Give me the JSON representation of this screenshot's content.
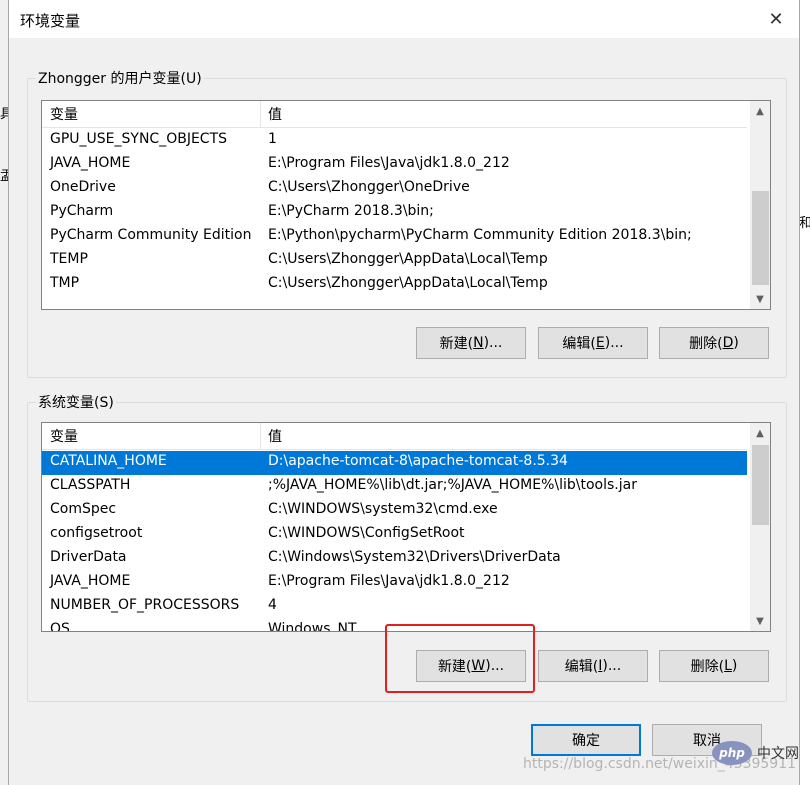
{
  "dialog": {
    "title": "环境变量"
  },
  "background_fragments": [
    "具。",
    "盂",
    "和"
  ],
  "user_vars": {
    "group_label": "Zhongger 的用户变量(U)",
    "headers": [
      "变量",
      "值"
    ],
    "rows": [
      {
        "name": "GPU_USE_SYNC_OBJECTS",
        "value": "1"
      },
      {
        "name": "JAVA_HOME",
        "value": "E:\\Program Files\\Java\\jdk1.8.0_212"
      },
      {
        "name": "OneDrive",
        "value": "C:\\Users\\Zhongger\\OneDrive"
      },
      {
        "name": "PyCharm",
        "value": "E:\\PyCharm 2018.3\\bin;"
      },
      {
        "name": "PyCharm Community Edition",
        "value": "E:\\Python\\pycharm\\PyCharm Community Edition 2018.3\\bin;"
      },
      {
        "name": "TEMP",
        "value": "C:\\Users\\Zhongger\\AppData\\Local\\Temp"
      },
      {
        "name": "TMP",
        "value": "C:\\Users\\Zhongger\\AppData\\Local\\Temp"
      }
    ],
    "buttons": {
      "new": {
        "prefix": "新建(",
        "key": "N",
        "suffix": ")..."
      },
      "edit": {
        "prefix": "编辑(",
        "key": "E",
        "suffix": ")..."
      },
      "delete": {
        "prefix": "删除(",
        "key": "D",
        "suffix": ")"
      }
    }
  },
  "system_vars": {
    "group_label": "系统变量(S)",
    "headers": [
      "变量",
      "值"
    ],
    "rows": [
      {
        "name": "CATALINA_HOME",
        "value": "D:\\apache-tomcat-8\\apache-tomcat-8.5.34",
        "selected": true
      },
      {
        "name": "CLASSPATH",
        "value": ";%JAVA_HOME%\\lib\\dt.jar;%JAVA_HOME%\\lib\\tools.jar"
      },
      {
        "name": "ComSpec",
        "value": "C:\\WINDOWS\\system32\\cmd.exe"
      },
      {
        "name": "configsetroot",
        "value": "C:\\WINDOWS\\ConfigSetRoot"
      },
      {
        "name": "DriverData",
        "value": "C:\\Windows\\System32\\Drivers\\DriverData"
      },
      {
        "name": "JAVA_HOME",
        "value": "E:\\Program Files\\Java\\jdk1.8.0_212"
      },
      {
        "name": "NUMBER_OF_PROCESSORS",
        "value": "4"
      },
      {
        "name": "OS",
        "value": "Windows_NT"
      }
    ],
    "buttons": {
      "new": {
        "prefix": "新建(",
        "key": "W",
        "suffix": ")..."
      },
      "edit": {
        "prefix": "编辑(",
        "key": "I",
        "suffix": ")..."
      },
      "delete": {
        "prefix": "删除(",
        "key": "L",
        "suffix": ")"
      }
    }
  },
  "footer": {
    "ok_label": "确定",
    "cancel_label": "取消"
  },
  "watermark": {
    "url": "https://blog.csdn.net/weixin_43395911",
    "logo": "php",
    "site": "中文网"
  },
  "colors": {
    "selection": "#0078d7",
    "highlight": "#e02020",
    "dialog_bg": "#f0f0f0"
  }
}
